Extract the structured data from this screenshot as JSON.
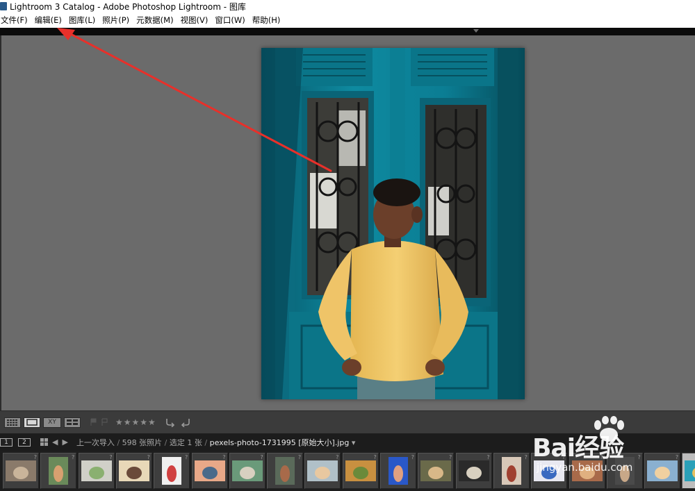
{
  "window": {
    "title": "Lightroom 3 Catalog - Adobe Photoshop Lightroom - 图库"
  },
  "menu": [
    {
      "label": "文件(F)"
    },
    {
      "label": "编辑(E)"
    },
    {
      "label": "图库(L)"
    },
    {
      "label": "照片(P)"
    },
    {
      "label": "元数据(M)"
    },
    {
      "label": "视图(V)"
    },
    {
      "label": "窗口(W)"
    },
    {
      "label": "帮助(H)"
    }
  ],
  "toolbar": {
    "views": [
      "grid-view-icon",
      "loupe-view-icon",
      "compare-view-icon",
      "survey-view-icon"
    ],
    "compare_label": "XY",
    "rating": "★★★★★",
    "rotate": [
      "rotate-left-icon",
      "rotate-right-icon"
    ]
  },
  "filmstrip_header": {
    "screen1": "1",
    "screen2": "2",
    "source": "上一次导入",
    "count": "598 张照片",
    "selected": "选定 1 张",
    "filename": "pexels-photo-1731995 [原始大小].jpg",
    "separator": "/"
  },
  "filmstrip": {
    "thumbnails": [
      {
        "id": "t1",
        "colors": [
          "#8a7a6a",
          "#c9b49a"
        ]
      },
      {
        "id": "t2",
        "colors": [
          "#6a8a5a",
          "#d8a070"
        ]
      },
      {
        "id": "t3",
        "colors": [
          "#d0d0c8",
          "#8ab070"
        ]
      },
      {
        "id": "t4",
        "colors": [
          "#e8d8b8",
          "#6a4a3a"
        ]
      },
      {
        "id": "t5",
        "colors": [
          "#f0f0f0",
          "#d04040"
        ]
      },
      {
        "id": "t6",
        "colors": [
          "#e8a888",
          "#4a6a8a"
        ]
      },
      {
        "id": "t7",
        "colors": [
          "#6a9a7a",
          "#d8d0c0"
        ]
      },
      {
        "id": "t8",
        "colors": [
          "#5a6a5a",
          "#a86a4a"
        ]
      },
      {
        "id": "t9",
        "colors": [
          "#b0c0c8",
          "#e8c8a0"
        ]
      },
      {
        "id": "t10",
        "colors": [
          "#c89040",
          "#6a8a3a"
        ]
      },
      {
        "id": "t11",
        "colors": [
          "#2a58c8",
          "#e0a080"
        ]
      },
      {
        "id": "t12",
        "colors": [
          "#6a6a4a",
          "#d8b888"
        ]
      },
      {
        "id": "t13",
        "colors": [
          "#2a2a2a",
          "#d8d0c0"
        ]
      },
      {
        "id": "t14",
        "colors": [
          "#d8c8b8",
          "#a04030"
        ]
      },
      {
        "id": "t15",
        "colors": [
          "#e8e8f0",
          "#3a6ac0"
        ]
      },
      {
        "id": "t16",
        "colors": [
          "#a86a4a",
          "#e0b080"
        ]
      },
      {
        "id": "t17",
        "colors": [
          "#4a4a4a",
          "#c8a888"
        ]
      },
      {
        "id": "t18",
        "colors": [
          "#8ab0d0",
          "#f0d0a0"
        ]
      },
      {
        "id": "t19",
        "colors": [
          "#2aa0b8",
          "#e8c060"
        ]
      }
    ],
    "selected_index": 18
  },
  "photo": {
    "subject_colors": {
      "door": "#0e8aa0",
      "door_dark": "#07596b",
      "sweater": "#f1c766",
      "skin": "#6b3f2a",
      "hair": "#1a1411",
      "jeans": "#5a7f86"
    }
  },
  "watermark": {
    "logo": "Bai经验",
    "url": "jingyan.baidu.com"
  },
  "annotation": {
    "color": "#e8302a"
  }
}
